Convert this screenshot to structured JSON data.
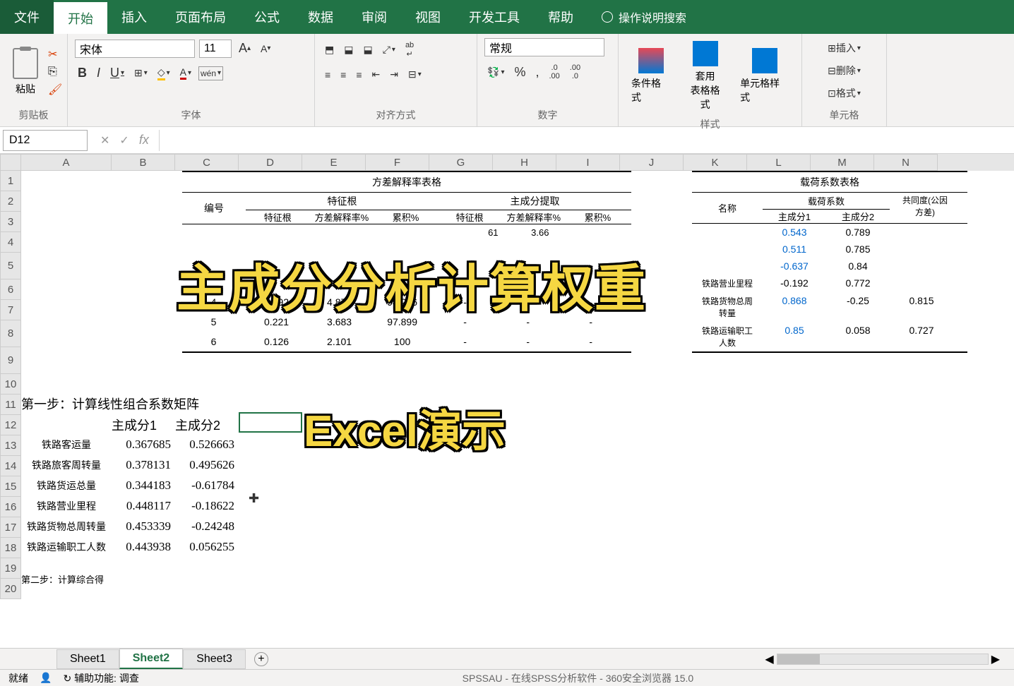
{
  "ribbon": {
    "tabs": [
      "文件",
      "开始",
      "插入",
      "页面布局",
      "公式",
      "数据",
      "审阅",
      "视图",
      "开发工具",
      "帮助"
    ],
    "search": "操作说明搜索",
    "groups": {
      "clipboard": "剪贴板",
      "paste": "粘贴",
      "font": "字体",
      "fontName": "宋体",
      "fontSize": "11",
      "alignment": "对齐方式",
      "number": "数字",
      "numberFormat": "常规",
      "styles": "样式",
      "condFormat": "条件格式",
      "tableFormat": "套用\n表格格式",
      "cellStyle": "单元格样式",
      "cells": "单元格",
      "insert": "插入",
      "delete": "删除",
      "format": "格式"
    }
  },
  "namebox": "D12",
  "colHeaders": [
    "A",
    "B",
    "C",
    "D",
    "E",
    "F",
    "G",
    "H",
    "I",
    "J",
    "K",
    "L",
    "M",
    "N"
  ],
  "rowHeaders": [
    "1",
    "2",
    "3",
    "4",
    "5",
    "6",
    "7",
    "8",
    "9",
    "10",
    "11",
    "12",
    "13",
    "14",
    "15",
    "16",
    "17",
    "18",
    "19",
    "20"
  ],
  "table1": {
    "title": "方差解释率表格",
    "h_num": "编号",
    "h_eigen": "特征根",
    "h_extract": "主成分提取",
    "sub_eigen": "特征根",
    "sub_varpct": "方差解释率%",
    "sub_cum": "累积%",
    "rows": [
      {
        "n": "4",
        "e": "0.292",
        "v": "4.872",
        "c": "94.216",
        "e2": "-",
        "v2": "-",
        "c2": "-"
      },
      {
        "n": "5",
        "e": "0.221",
        "v": "3.683",
        "c": "97.899",
        "e2": "-",
        "v2": "-",
        "c2": "-"
      },
      {
        "n": "6",
        "e": "0.126",
        "v": "2.101",
        "c": "100",
        "e2": "-",
        "v2": "-",
        "c2": "-"
      }
    ],
    "partial": {
      "e": "61",
      "g": "3.66"
    }
  },
  "table2": {
    "title": "载荷系数表格",
    "h_name": "名称",
    "h_load": "载荷系数",
    "h_comm": "共同度(公因\n方差)",
    "h_pc1": "主成分1",
    "h_pc2": "主成分2",
    "rows": [
      {
        "name": "",
        "pc1": "0.543",
        "pc2": "0.789"
      },
      {
        "name": "",
        "pc1": "0.511",
        "pc2": "0.785"
      },
      {
        "name": "",
        "pc1": "-0.637",
        "pc2": "0.84"
      },
      {
        "name": "铁路营业里程",
        "pc1": "-0.192",
        "pc2": "0.772"
      },
      {
        "name": "铁路货物总周\n转量",
        "pc1b": "0.868",
        "pc2": "-0.25",
        "comm": "0.815"
      },
      {
        "name": "铁路运输职工\n人数",
        "pc1b": "0.85",
        "pc2": "0.058",
        "comm": "0.727"
      }
    ]
  },
  "step1": {
    "title": "第一步：计算线性组合系数矩阵",
    "h_pc1": "主成分1",
    "h_pc2": "主成分2",
    "rows": [
      {
        "name": "铁路客运量",
        "v1": "0.367685",
        "v2": "0.526663"
      },
      {
        "name": "铁路旅客周转量",
        "v1": "0.378131",
        "v2": "0.495626"
      },
      {
        "name": "铁路货运总量",
        "v1": "0.344183",
        "v2": "-0.61784"
      },
      {
        "name": "铁路营业里程",
        "v1": "0.448117",
        "v2": "-0.18622"
      },
      {
        "name": "铁路货物总周转量",
        "v1": "0.453339",
        "v2": "-0.24248"
      },
      {
        "name": "铁路运输职工人数",
        "v1": "0.443938",
        "v2": "0.056255"
      }
    ]
  },
  "step2": "第二步：计算综合得",
  "overlays": {
    "main": "主成分分析计算权重",
    "sub": "Excel演示"
  },
  "sheets": [
    "Sheet1",
    "Sheet2",
    "Sheet3"
  ],
  "activeSheet": "Sheet2",
  "status": {
    "ready": "就绪",
    "access": "辅助功能: 调查",
    "browser": "SPSSAU - 在线SPSS分析软件 - 360安全浏览器 15.0"
  }
}
